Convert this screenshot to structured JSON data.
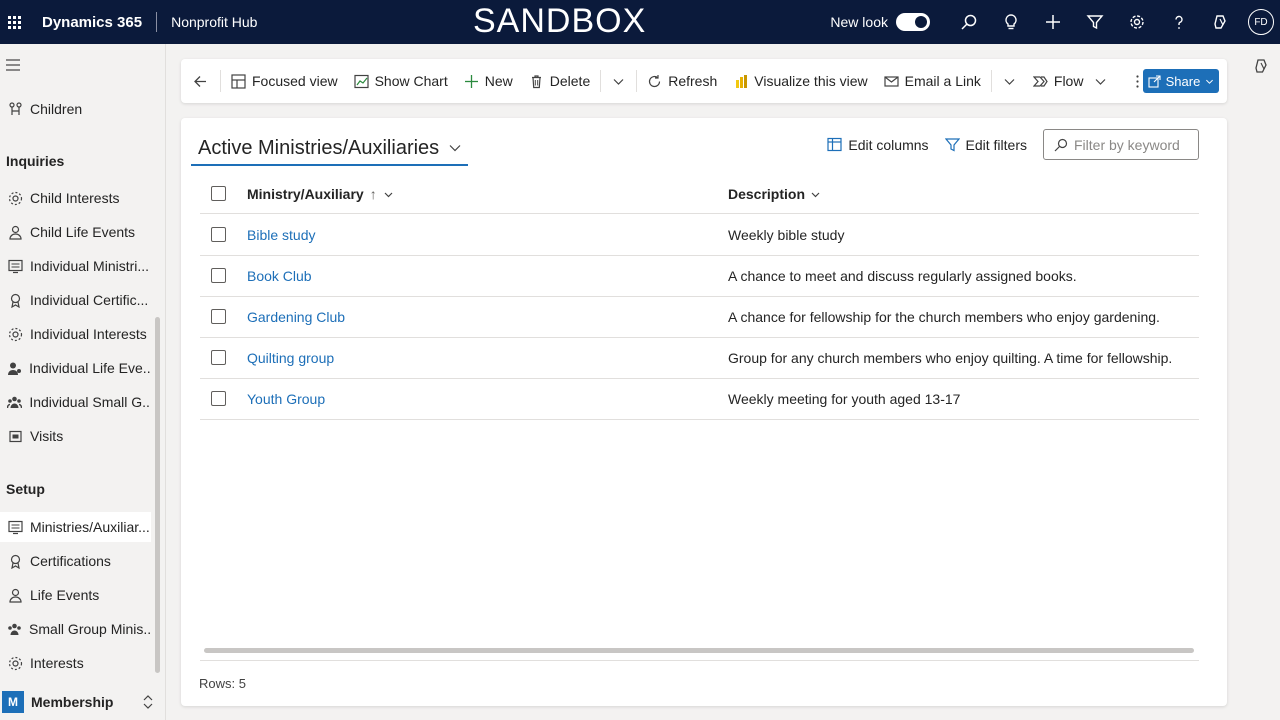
{
  "topbar": {
    "app_name": "Dynamics 365",
    "hub_name": "Nonprofit Hub",
    "environment_banner": "SANDBOX",
    "new_look_label": "New look",
    "new_look_on": true,
    "avatar_initials": "FD",
    "icons": [
      "waffle-icon",
      "search-icon",
      "lightbulb-icon",
      "plus-icon",
      "filter-icon",
      "gear-icon",
      "help-icon",
      "copilot-icon"
    ]
  },
  "sidebar": {
    "top_items": [
      {
        "label": "Children",
        "icon": "people-tree-icon"
      }
    ],
    "groups": [
      {
        "title": "Inquiries",
        "items": [
          {
            "label": "Child Interests",
            "icon": "interests-icon"
          },
          {
            "label": "Child Life Events",
            "icon": "person-icon"
          },
          {
            "label": "Individual Ministri...",
            "icon": "ministry-icon"
          },
          {
            "label": "Individual Certific...",
            "icon": "certificate-icon"
          },
          {
            "label": "Individual Interests",
            "icon": "interests-icon"
          },
          {
            "label": "Individual Life Eve...",
            "icon": "person-event-icon"
          },
          {
            "label": "Individual Small G...",
            "icon": "group-icon"
          },
          {
            "label": "Visits",
            "icon": "calendar-icon"
          }
        ]
      },
      {
        "title": "Setup",
        "items": [
          {
            "label": "Ministries/Auxiliar...",
            "icon": "ministry-icon",
            "selected": true
          },
          {
            "label": "Certifications",
            "icon": "certificate-icon"
          },
          {
            "label": "Life Events",
            "icon": "person-icon"
          },
          {
            "label": "Small Group Minis...",
            "icon": "group-icon"
          },
          {
            "label": "Interests",
            "icon": "interests-icon"
          }
        ]
      }
    ],
    "area": {
      "badge": "M",
      "label": "Membership"
    }
  },
  "commandbar": {
    "items": [
      {
        "label": "Focused view",
        "icon": "focused-view-icon"
      },
      {
        "label": "Show Chart",
        "icon": "chart-icon"
      },
      {
        "label": "New",
        "icon": "plus-icon"
      },
      {
        "label": "Delete",
        "icon": "trash-icon"
      },
      {
        "label": "Refresh",
        "icon": "refresh-icon"
      },
      {
        "label": "Visualize this view",
        "icon": "powerbi-icon"
      },
      {
        "label": "Email a Link",
        "icon": "email-link-icon"
      },
      {
        "label": "Flow",
        "icon": "flow-icon"
      }
    ],
    "share_label": "Share"
  },
  "view": {
    "title": "Active Ministries/Auxiliaries",
    "edit_columns": "Edit columns",
    "edit_filters": "Edit filters",
    "filter_placeholder": "Filter by keyword",
    "columns": [
      "Ministry/Auxiliary",
      "Description"
    ],
    "sort_indicator": "↑",
    "rows": [
      {
        "name": "Bible study",
        "description": "Weekly bible study"
      },
      {
        "name": "Book Club",
        "description": "A chance to meet and discuss regularly assigned books."
      },
      {
        "name": "Gardening Club",
        "description": "A chance for fellowship for the church members who enjoy gardening."
      },
      {
        "name": "Quilting group",
        "description": "Group for any church members who enjoy quilting. A time for fellowship."
      },
      {
        "name": "Youth Group",
        "description": "Weekly meeting for youth aged 13-17"
      }
    ],
    "rows_count": "Rows: 5"
  },
  "colors": {
    "topbar_bg": "#0b1a3b",
    "accent": "#1d6fb8",
    "link": "#1d6fb8"
  }
}
